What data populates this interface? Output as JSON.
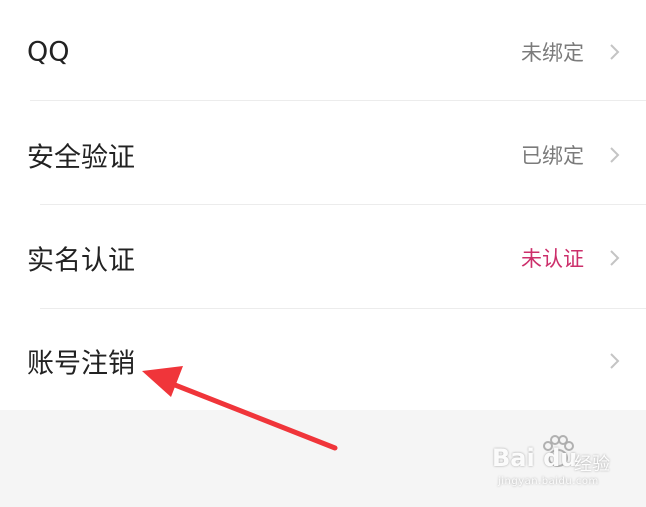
{
  "settings": {
    "rows": [
      {
        "label": "QQ",
        "value": "未绑定",
        "status": "normal",
        "chevron_icon": "chevron-right-icon"
      },
      {
        "label": "安全验证",
        "value": "已绑定",
        "status": "normal",
        "chevron_icon": "chevron-right-icon"
      },
      {
        "label": "实名认证",
        "value": "未认证",
        "status": "warning",
        "chevron_icon": "chevron-right-icon"
      },
      {
        "label": "账号注销",
        "value": "",
        "status": "normal",
        "chevron_icon": "chevron-right-icon"
      }
    ]
  },
  "annotation": {
    "arrow_icon": "red-arrow-icon",
    "color": "#f0353a"
  },
  "watermark": {
    "brand": "Bai du",
    "sub": "经验",
    "url": "jingyan.baidu.com"
  },
  "colors": {
    "background": "#f5f5f5",
    "list_background": "#ffffff",
    "label_text": "#222222",
    "value_text": "#7b7b7b",
    "warning_text": "#cc2f6b",
    "chevron": "#c4c4c4"
  }
}
